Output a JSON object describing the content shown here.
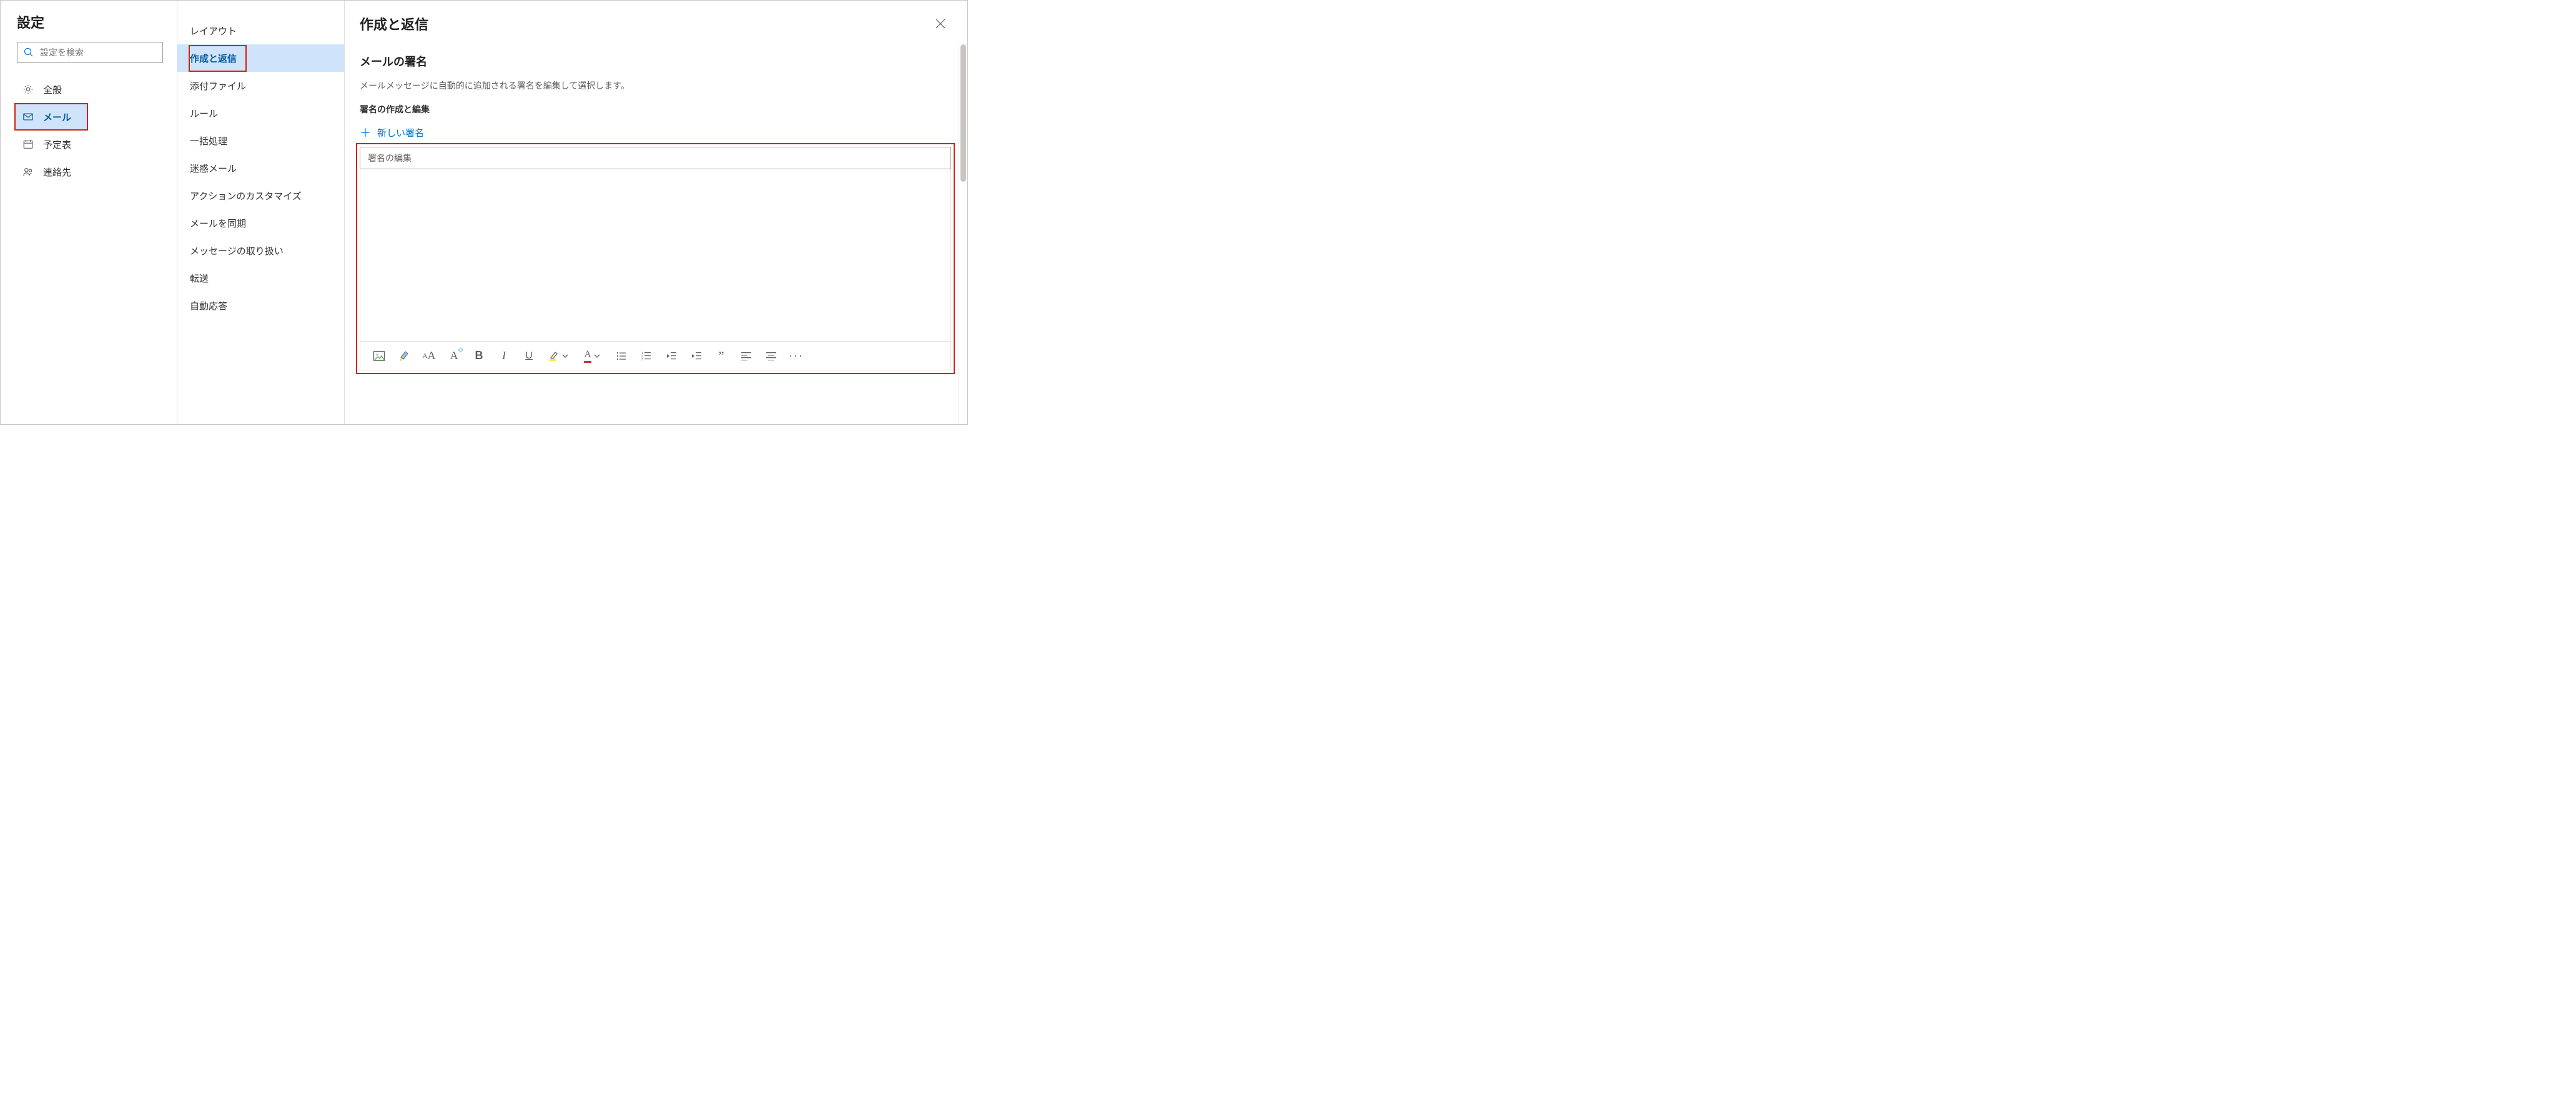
{
  "sidebar": {
    "title": "設定",
    "search_placeholder": "設定を検索",
    "categories": [
      {
        "id": "general",
        "label": "全般",
        "icon": "gear-icon",
        "selected": false,
        "highlight": false
      },
      {
        "id": "mail",
        "label": "メール",
        "icon": "mail-icon",
        "selected": true,
        "highlight": true
      },
      {
        "id": "calendar",
        "label": "予定表",
        "icon": "calendar-icon",
        "selected": false,
        "highlight": false
      },
      {
        "id": "people",
        "label": "連絡先",
        "icon": "people-icon",
        "selected": false,
        "highlight": false
      }
    ]
  },
  "midnav": {
    "items": [
      {
        "id": "layout",
        "label": "レイアウト",
        "selected": false,
        "highlight": false
      },
      {
        "id": "compose-reply",
        "label": "作成と返信",
        "selected": true,
        "highlight": true
      },
      {
        "id": "attachments",
        "label": "添付ファイル",
        "selected": false,
        "highlight": false
      },
      {
        "id": "rules",
        "label": "ルール",
        "selected": false,
        "highlight": false
      },
      {
        "id": "sweep",
        "label": "一括処理",
        "selected": false,
        "highlight": false
      },
      {
        "id": "junk",
        "label": "迷惑メール",
        "selected": false,
        "highlight": false
      },
      {
        "id": "custom-actions",
        "label": "アクションのカスタマイズ",
        "selected": false,
        "highlight": false
      },
      {
        "id": "sync",
        "label": "メールを同期",
        "selected": false,
        "highlight": false
      },
      {
        "id": "handling",
        "label": "メッセージの取り扱い",
        "selected": false,
        "highlight": false
      },
      {
        "id": "forwarding",
        "label": "転送",
        "selected": false,
        "highlight": false
      },
      {
        "id": "autoreply",
        "label": "自動応答",
        "selected": false,
        "highlight": false
      }
    ]
  },
  "main": {
    "title": "作成と返信",
    "signature": {
      "heading": "メールの署名",
      "description": "メールメッセージに自動的に追加される署名を編集して選択します。",
      "edit_label": "署名の作成と編集",
      "add_new": "新しい署名",
      "name_placeholder": "署名の編集"
    }
  },
  "toolbar": {
    "buttons": [
      {
        "id": "image",
        "icon": "image-icon"
      },
      {
        "id": "formatpaint",
        "icon": "format-painter-icon"
      },
      {
        "id": "fontsize",
        "icon": "font-size-icon"
      },
      {
        "id": "clearformat",
        "icon": "clear-format-icon"
      },
      {
        "id": "bold",
        "icon": "bold-icon"
      },
      {
        "id": "italic",
        "icon": "italic-icon"
      },
      {
        "id": "underline",
        "icon": "underline-icon"
      },
      {
        "id": "highlight",
        "icon": "highlight-icon",
        "dropdown": true
      },
      {
        "id": "fontcolor",
        "icon": "font-color-icon",
        "dropdown": true
      },
      {
        "id": "bullets",
        "icon": "bullet-list-icon"
      },
      {
        "id": "numbering",
        "icon": "number-list-icon"
      },
      {
        "id": "outdent",
        "icon": "outdent-icon"
      },
      {
        "id": "indent",
        "icon": "indent-icon"
      },
      {
        "id": "quote",
        "icon": "quote-icon"
      },
      {
        "id": "alignleft",
        "icon": "align-left-icon"
      },
      {
        "id": "aligncenter",
        "icon": "align-center-icon"
      },
      {
        "id": "more",
        "icon": "more-icon"
      }
    ]
  }
}
